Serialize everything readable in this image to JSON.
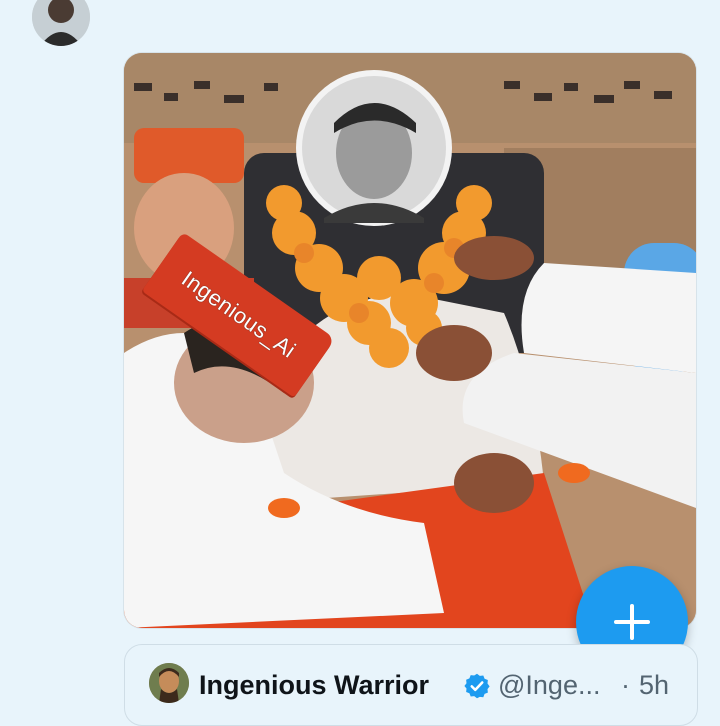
{
  "tweet": {
    "image_watermark": "Ingenious_Ai"
  },
  "quoted_tweet": {
    "display_name": "Ingenious Warrior",
    "handle": "@Inge...",
    "separator": "·",
    "timestamp": "5h"
  },
  "colors": {
    "background": "#e8f4fb",
    "accent": "#1d9bf0",
    "saffron": "#d43b22",
    "marigold": "#f29a2e"
  }
}
